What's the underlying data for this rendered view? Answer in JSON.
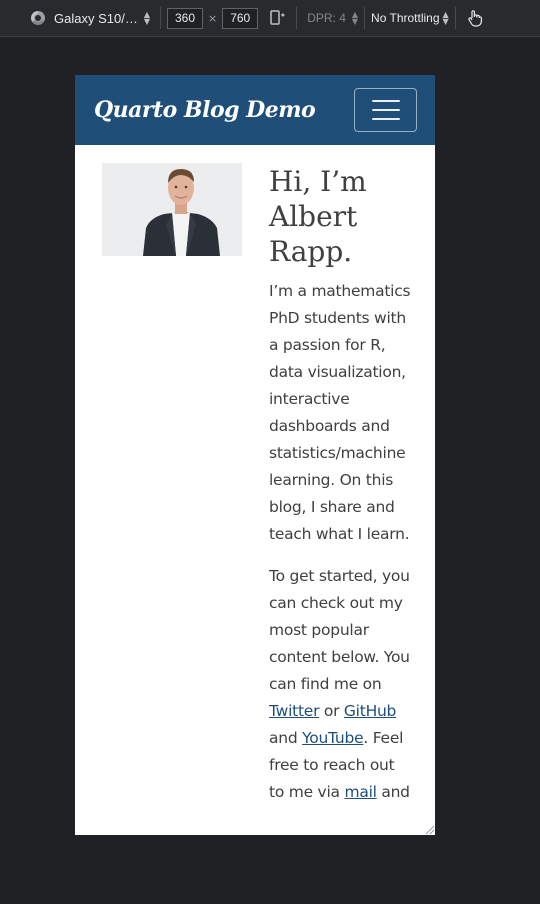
{
  "toolbar": {
    "device": "Galaxy S10/…",
    "width": "360",
    "height": "760",
    "times": "×",
    "dpr": "DPR: 4",
    "throttling": "No Throttling"
  },
  "navbar": {
    "brand": "Quarto Blog Demo"
  },
  "profile": {
    "heading": "Hi, I’m Albert Rapp.",
    "intro": "I’m a mathematics PhD students with a passion for R, data visualization, interactive dashboards and statistics/machine learning. On this blog, I share and teach what I learn.",
    "p2_start": "To get started, you can check out my most popular content below. You can find me on ",
    "twitter": "Twitter",
    "or": " or ",
    "github": "GitHub",
    "and1": " and ",
    "youtube": "YouTube",
    "feel_free": ". Feel free to reach out to me via ",
    "mail": "mail",
    "and2": " and"
  },
  "colors": {
    "navbar": "#1f4e79",
    "link": "#1f4e79",
    "text": "#404040"
  }
}
